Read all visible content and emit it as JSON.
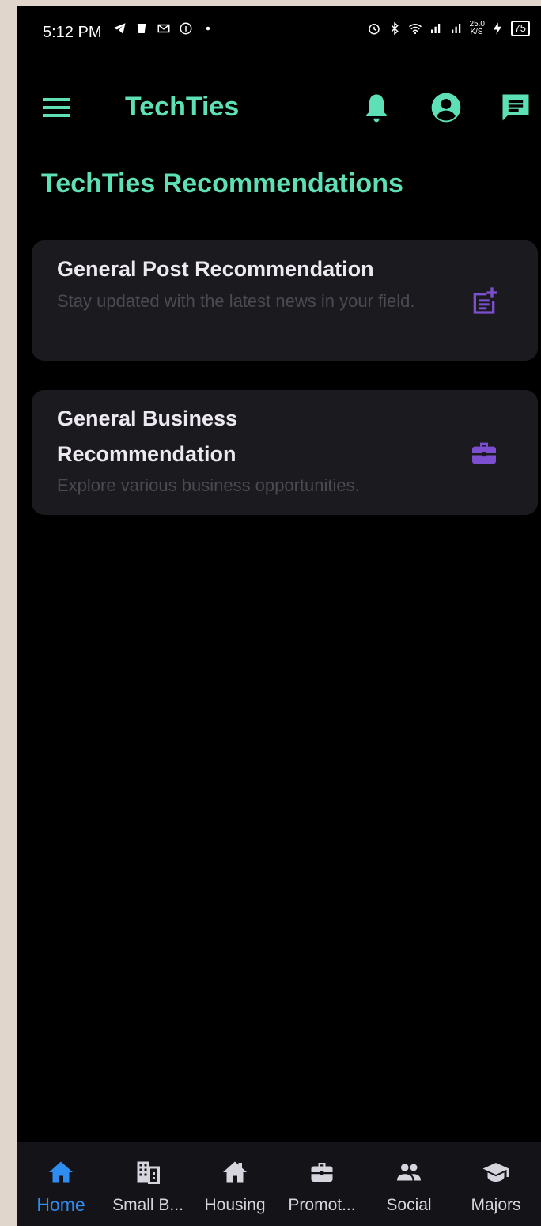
{
  "status_bar": {
    "time": "5:12 PM",
    "net_speed_top": "25.0",
    "net_speed_bottom": "K/S",
    "battery": "75"
  },
  "app_bar": {
    "title": "TechTies",
    "icons": [
      "menu-icon",
      "bell-icon",
      "account-circle-icon",
      "chat-icon"
    ]
  },
  "main": {
    "section_title": "TechTies Recommendations",
    "cards": [
      {
        "title": "General Post Recommendation",
        "subtitle": "Stay updated with the latest news in your field.",
        "icon": "post-add-icon"
      },
      {
        "title": "General Business Recommendation",
        "subtitle": "Explore various business opportunities.",
        "icon": "briefcase-icon"
      }
    ]
  },
  "bottom_nav": {
    "items": [
      {
        "label": "Home",
        "icon": "home-icon",
        "active": true
      },
      {
        "label": "Small B...",
        "icon": "building-icon"
      },
      {
        "label": "Housing",
        "icon": "house-icon"
      },
      {
        "label": "Promot...",
        "icon": "briefcase-icon"
      },
      {
        "label": "Social",
        "icon": "people-icon"
      },
      {
        "label": "Majors",
        "icon": "graduation-cap-icon"
      }
    ]
  },
  "colors": {
    "accent": "#5ee0b6",
    "icon_purple": "#7b4fd0",
    "nav_active": "#2f8cf0",
    "background": "#000000",
    "card": "#1b1a1f"
  }
}
